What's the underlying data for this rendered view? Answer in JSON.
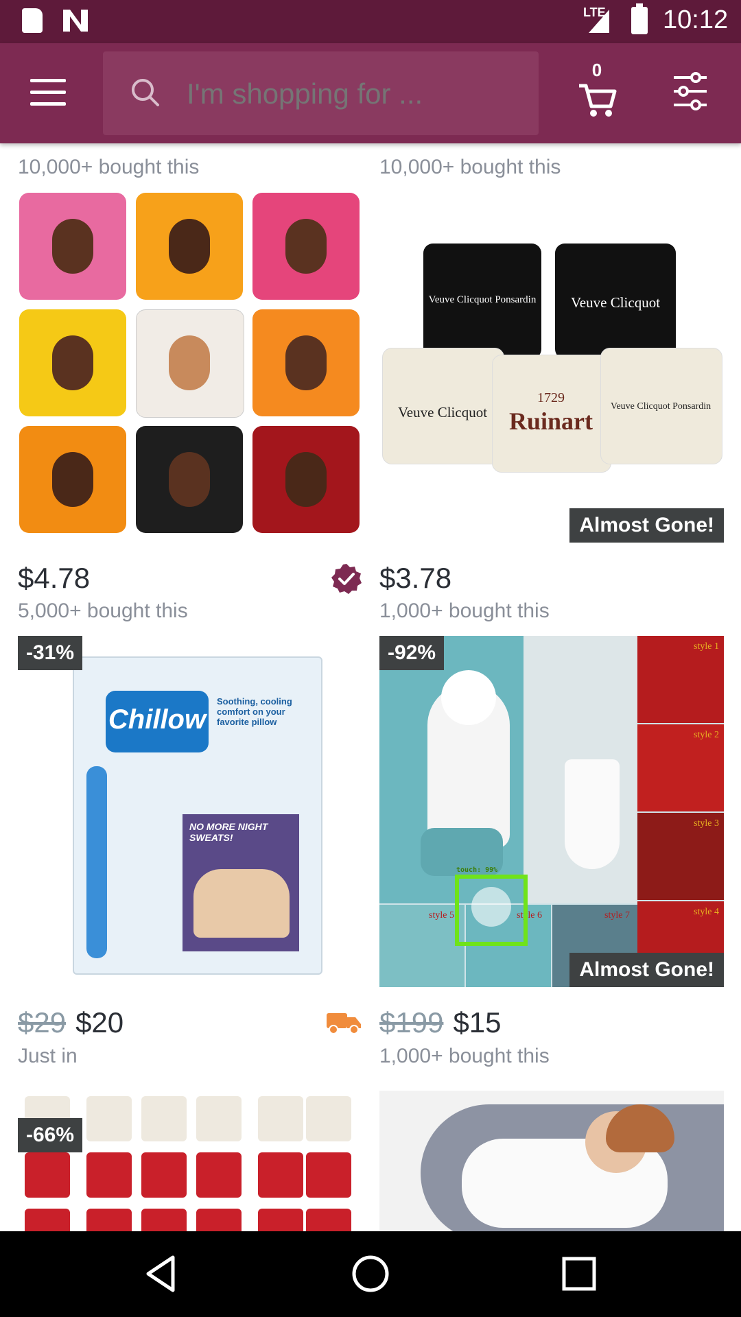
{
  "status_bar": {
    "time": "10:12",
    "network": "LTE"
  },
  "app_bar": {
    "search_placeholder": "I'm shopping for ...",
    "cart_count": "0"
  },
  "products": [
    {
      "bought_top": "10,000+ bought this",
      "price": "$4.78",
      "sub": "5,000+ bought this",
      "icon": "verified-icon"
    },
    {
      "bought_top": "10,000+ bought this",
      "price": "$3.78",
      "sub": "1,000+ bought this",
      "badge": "Almost Gone!",
      "pillow_text": [
        "Veuve Clicquot Ponsardin",
        "Veuve Clicquot",
        "Veuve Clicquot",
        "1729",
        "Ruinart",
        "Veuve Clicquot Ponsardin"
      ]
    },
    {
      "discount": "-31%",
      "old_price": "$29",
      "price": "$20",
      "sub": "Just in",
      "icon": "truck-icon",
      "box_text": {
        "brand": "Chillow",
        "tagline": "Soothing, cooling comfort on your favorite pillow",
        "callout": "NO MORE NIGHT SWEATS!"
      }
    },
    {
      "discount": "-92%",
      "old_price": "$199",
      "price": "$15",
      "sub": "1,000+ bought this",
      "badge": "Almost Gone!",
      "styles": [
        "style 1",
        "style 2",
        "style 3",
        "style 4",
        "style 5",
        "style 6",
        "style 7"
      ],
      "touch_label": "touch: 99%"
    },
    {
      "discount": "-66%"
    },
    {}
  ],
  "colors": {
    "status_bar": "#5e1a3a",
    "app_bar": "#7d2a52",
    "badge": "#3e4142",
    "verified": "#7d2a52",
    "truck": "#f08c3c",
    "touch": "#6fe31a"
  }
}
